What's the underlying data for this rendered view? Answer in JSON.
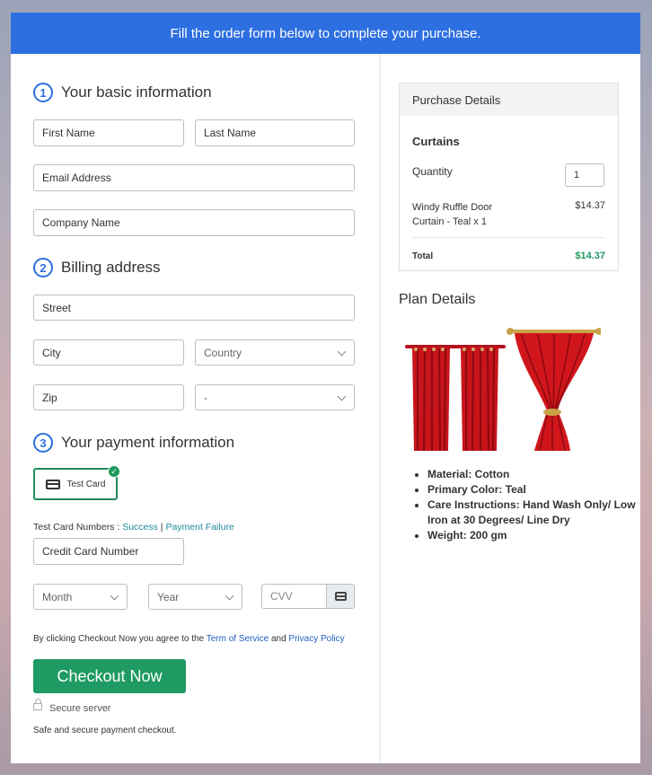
{
  "banner": "Fill the order form below to complete your purchase.",
  "sections": {
    "basic": {
      "num": "1",
      "title": "Your basic information"
    },
    "billing": {
      "num": "2",
      "title": "Billing address"
    },
    "payment": {
      "num": "3",
      "title": "Your payment information"
    }
  },
  "fields": {
    "first_name": "First Name",
    "last_name": "Last Name",
    "email": "Email Address",
    "company": "Company Name",
    "street": "Street",
    "city": "City",
    "country": "Country",
    "zip": "Zip",
    "state": "-",
    "card_number": "Credit Card Number",
    "month": "Month",
    "year": "Year",
    "cvv": "CVV"
  },
  "payment": {
    "test_card_label": "Test Card",
    "test_numbers_label": "Test Card Numbers : ",
    "success": "Success",
    "separator": " | ",
    "failure": "Payment Failure"
  },
  "agreement": {
    "prefix": "By clicking Checkout Now you agree to the ",
    "tos": "Term of Service",
    "and": " and ",
    "privacy": "Privacy Policy"
  },
  "checkout_label": "Checkout Now",
  "secure_server": "Secure server",
  "secure_note": "Safe and secure payment checkout.",
  "purchase": {
    "heading": "Purchase Details",
    "product": "Curtains",
    "quantity_label": "Quantity",
    "quantity_value": "1",
    "item_line1": "Windy Ruffle Door",
    "item_line2": "Curtain - Teal x 1",
    "item_price": "$14.37",
    "total_label": "Total",
    "total_value": "$14.37",
    "total_color": "#1f9a62"
  },
  "plan": {
    "heading": "Plan Details",
    "bullets": [
      "Material: Cotton",
      "Primary Color: Teal",
      "Care Instructions: Hand Wash Only/ Low Iron at 30 Degrees/ Line Dry",
      "Weight: 200 gm"
    ]
  },
  "colors": {
    "accent": "#2d6fe0",
    "checkout": "#1f9a62",
    "curtain": "#d0161b"
  }
}
